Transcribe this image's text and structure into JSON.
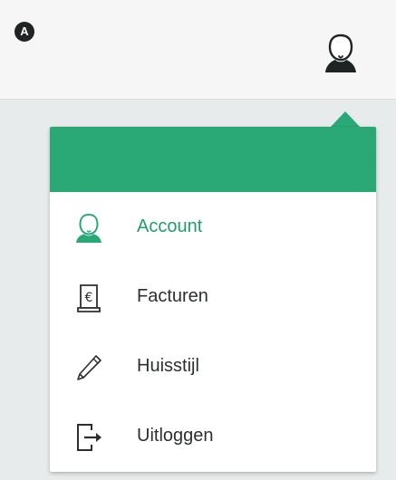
{
  "marker": {
    "label": "A"
  },
  "header": {
    "account_icon": "user-avatar-icon"
  },
  "menu": {
    "items": [
      {
        "label": "Account",
        "icon": "user-avatar-icon",
        "active": true
      },
      {
        "label": "Facturen",
        "icon": "invoice-euro-icon"
      },
      {
        "label": "Huisstijl",
        "icon": "pencil-icon"
      },
      {
        "label": "Uitloggen",
        "icon": "logout-icon"
      }
    ]
  },
  "colors": {
    "accent": "#2aa876",
    "active_text": "#239c6b",
    "text": "#2c2f31",
    "icon_dark": "#1f2324",
    "topbar_bg": "#f6f6f6",
    "page_bg": "#e8ebeb"
  }
}
